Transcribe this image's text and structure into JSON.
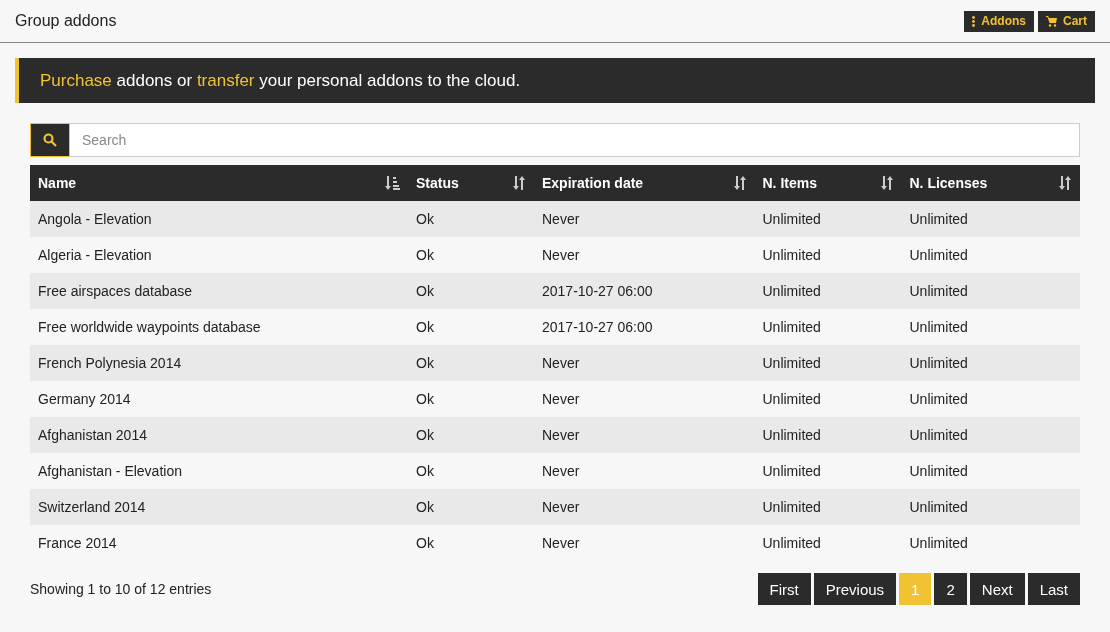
{
  "header": {
    "title": "Group addons",
    "buttons": [
      {
        "kind": "menu",
        "label": "Addons"
      },
      {
        "kind": "cart",
        "label": "Cart"
      }
    ]
  },
  "banner": [
    {
      "text": "Purchase",
      "highlight": true
    },
    {
      "text": " addons or ",
      "highlight": false
    },
    {
      "text": "transfer",
      "highlight": true
    },
    {
      "text": " your personal addons to the cloud.",
      "highlight": false
    }
  ],
  "search": {
    "placeholder": "Search"
  },
  "table": {
    "columns": [
      {
        "label": "Name",
        "sorted": true
      },
      {
        "label": "Status",
        "sorted": false
      },
      {
        "label": "Expiration date",
        "sorted": false
      },
      {
        "label": "N. Items",
        "sorted": false
      },
      {
        "label": "N. Licenses",
        "sorted": false
      }
    ],
    "rows": [
      [
        "Angola - Elevation",
        "Ok",
        "Never",
        "Unlimited",
        "Unlimited"
      ],
      [
        "Algeria - Elevation",
        "Ok",
        "Never",
        "Unlimited",
        "Unlimited"
      ],
      [
        "Free airspaces database",
        "Ok",
        "2017-10-27 06:00",
        "Unlimited",
        "Unlimited"
      ],
      [
        "Free worldwide waypoints database",
        "Ok",
        "2017-10-27 06:00",
        "Unlimited",
        "Unlimited"
      ],
      [
        "French Polynesia 2014",
        "Ok",
        "Never",
        "Unlimited",
        "Unlimited"
      ],
      [
        "Germany 2014",
        "Ok",
        "Never",
        "Unlimited",
        "Unlimited"
      ],
      [
        "Afghanistan 2014",
        "Ok",
        "Never",
        "Unlimited",
        "Unlimited"
      ],
      [
        "Afghanistan - Elevation",
        "Ok",
        "Never",
        "Unlimited",
        "Unlimited"
      ],
      [
        "Switzerland 2014",
        "Ok",
        "Never",
        "Unlimited",
        "Unlimited"
      ],
      [
        "France 2014",
        "Ok",
        "Never",
        "Unlimited",
        "Unlimited"
      ]
    ]
  },
  "info": "Showing 1 to 10 of 12 entries",
  "pagination": [
    {
      "label": "First",
      "selected": false
    },
    {
      "label": "Previous",
      "selected": false
    },
    {
      "label": "1",
      "selected": true
    },
    {
      "label": "2",
      "selected": false
    },
    {
      "label": "Next",
      "selected": false
    },
    {
      "label": "Last",
      "selected": false
    }
  ]
}
